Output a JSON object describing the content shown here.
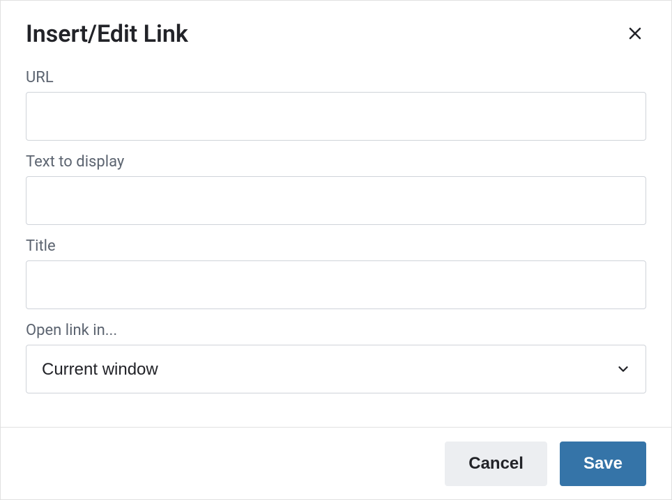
{
  "dialog": {
    "title": "Insert/Edit Link",
    "fields": {
      "url": {
        "label": "URL",
        "value": ""
      },
      "text_to_display": {
        "label": "Text to display",
        "value": ""
      },
      "title": {
        "label": "Title",
        "value": ""
      },
      "open_link_in": {
        "label": "Open link in...",
        "selected": "Current window"
      }
    },
    "buttons": {
      "cancel": "Cancel",
      "save": "Save"
    }
  }
}
